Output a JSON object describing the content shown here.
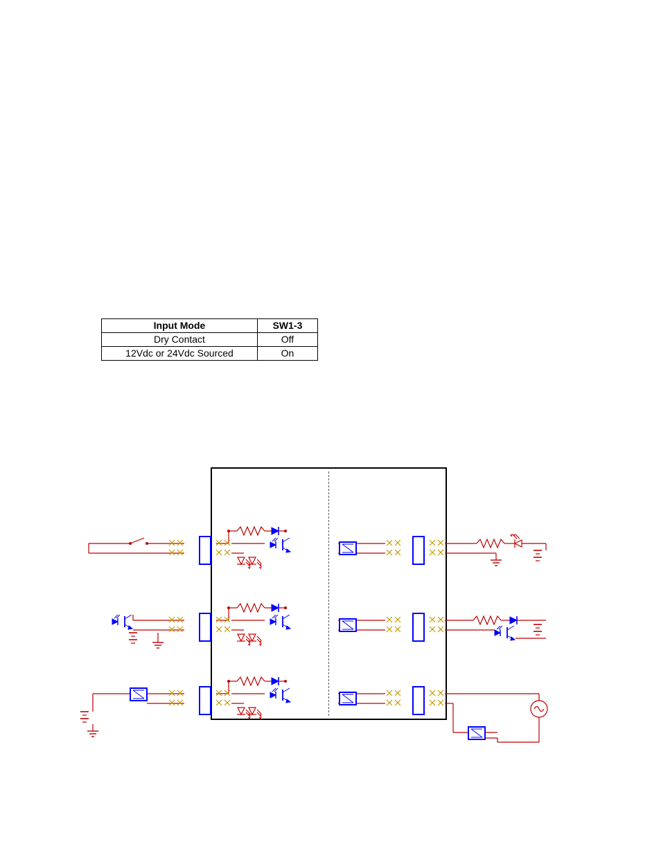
{
  "table": {
    "headers": [
      "Input Mode",
      "SW1-3"
    ],
    "rows": [
      [
        "Dry Contact",
        "Off"
      ],
      [
        "12Vdc or 24Vdc Sourced",
        "On"
      ]
    ]
  },
  "schematic": {
    "left_rows": [
      {
        "id": "dry-contact-input"
      },
      {
        "id": "transistor-open-collector-input"
      },
      {
        "id": "sourced-dc-relay-input"
      }
    ],
    "right_rows": [
      {
        "id": "dc-led-load-output"
      },
      {
        "id": "opto-isolated-output"
      },
      {
        "id": "ac-relay-output"
      }
    ]
  }
}
